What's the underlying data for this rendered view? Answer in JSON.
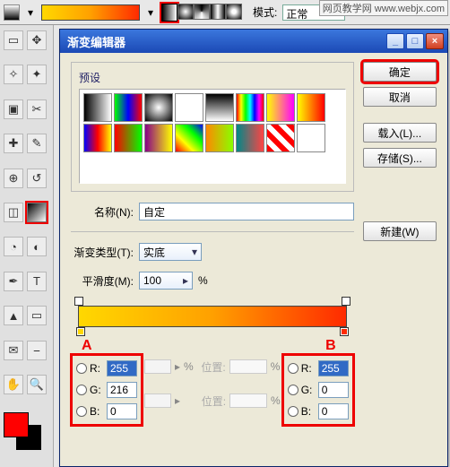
{
  "topbar": {
    "mode_label": "模式:",
    "mode_value": "正常",
    "watermark": "网页教学网 www.webjx.com"
  },
  "tools": [
    "▭",
    "⇱",
    "✧",
    "↗",
    "▢",
    "✎",
    "⌄",
    "✚",
    "✒",
    "✂",
    "◧",
    "T",
    "▲",
    "✥",
    "⊡",
    "◫",
    "◰",
    "⋯",
    "↺",
    "⊕",
    "⬚",
    "◑"
  ],
  "fg_color": "#ff0000",
  "bg_color": "#000000",
  "dialog": {
    "title": "渐变编辑器",
    "buttons": {
      "ok": "确定",
      "cancel": "取消",
      "load": "载入(L)...",
      "save": "存储(S)...",
      "new": "新建(W)"
    },
    "preset_label": "预设",
    "name_label": "名称(N):",
    "name_value": "自定",
    "type_label": "渐变类型(T):",
    "type_value": "实底",
    "smooth_label": "平滑度(M):",
    "smooth_value": "100",
    "smooth_unit": "%",
    "pos_label": "位置:",
    "pos_unit": "%",
    "markers": {
      "a": "A",
      "b": "B"
    },
    "rgb_a": {
      "r": "255",
      "g": "216",
      "b": "0"
    },
    "rgb_b": {
      "r": "255",
      "g": "0",
      "b": "0"
    },
    "presets": [
      "linear-gradient(to right,#000,#fff)",
      "linear-gradient(to right,#0f0,#00f,#f00)",
      "radial-gradient(#fff,#000)",
      "linear-gradient(to right,#fff,transparent)",
      "linear-gradient(to bottom,#000,#fff)",
      "linear-gradient(to right,#f00,#ff0,#0f0,#0ff,#00f,#f0f,#f00)",
      "linear-gradient(to right,#ff0,#f0f)",
      "linear-gradient(to right,#ff0,#f00)",
      "linear-gradient(to right,#00f,#f00,#ff0)",
      "linear-gradient(to right,#f00,#0f0)",
      "linear-gradient(to right,#808,#ff0)",
      "linear-gradient(45deg,#f00,#ff0,#0f0,#00f)",
      "linear-gradient(to right,#f80,#8f0)",
      "linear-gradient(to right,#088,#f44)",
      "repeating-linear-gradient(45deg,#f00 0 6px,#fff 6px 12px)",
      "#fff"
    ]
  }
}
